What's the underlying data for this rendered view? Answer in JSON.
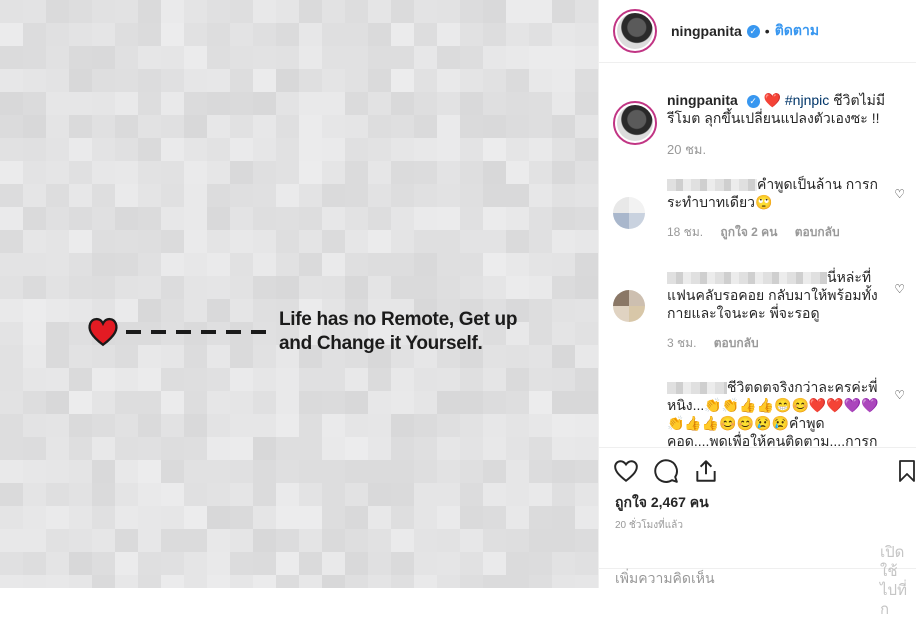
{
  "post_image": {
    "quote_line_1": "Life has no Remote, Get up",
    "quote_line_2": "and Change it Yourself."
  },
  "header": {
    "username": "ningpanita",
    "separator": "•",
    "follow_label": "ติดตาม"
  },
  "caption": {
    "username": "ningpanita",
    "heart": "❤️",
    "hashtag": "#njnpic",
    "text": " ชีวิตไม่มีรีโมต ลุกขึ้นเปลี่ยนแปลงตัวเองซะ !!",
    "time": "20 ชม."
  },
  "comments": [
    {
      "text": "คำพูดเป็นล้าน การกระทำบาทเดียว🙄",
      "time": "18 ชม.",
      "likes": "ถูกใจ 2 คน",
      "reply": "ตอบกลับ"
    },
    {
      "text": "นี่หล่ะที่แฟนคลับรอคอย กลับมาให้พร้อมทั้งกายและใจนะคะ พี่จะรอดู",
      "time": "3 ชม.",
      "reply": "ตอบกลับ"
    },
    {
      "text": "ชีวิตดตจริงกว่าละครค่ะพี่หนิง...👏👏👍👍😁😊❤️❤️💜💜👏👍👍😊😊😢😢คำพูด คอด....พดเพื่อให้คนติดตาม....การกระ"
    }
  ],
  "actions": {
    "likes_text": "ถูกใจ 2,467 คน",
    "time_ago": "20 ชั่วโมงที่แล้ว",
    "add_comment_placeholder": "เพิ่มความคิดเห็น"
  },
  "watermark": {
    "line1": "เปิดใช้",
    "line2": "ไปที่ก"
  },
  "colors": {
    "accent": "#3897f0",
    "heart": "#e31b23",
    "story_ring": "#c13584"
  }
}
